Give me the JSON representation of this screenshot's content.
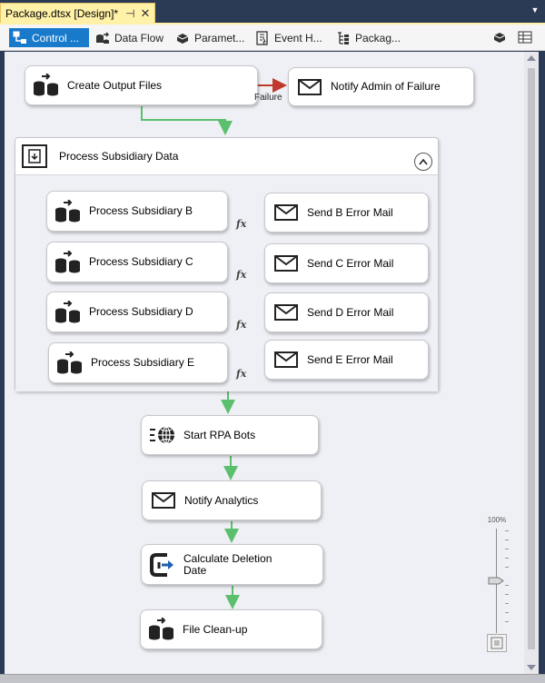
{
  "document_tab": {
    "title": "Package.dtsx [Design]*",
    "pin_glyph": "⊣",
    "close_glyph": "✕"
  },
  "toolbar": {
    "tabs": [
      {
        "label": "Control ...",
        "icon": "control-flow-icon",
        "active": true
      },
      {
        "label": "Data Flow",
        "icon": "data-flow-icon",
        "active": false
      },
      {
        "label": "Paramet...",
        "icon": "parameters-icon",
        "active": false
      },
      {
        "label": "Event H...",
        "icon": "event-handlers-icon",
        "active": false
      },
      {
        "label": "Packag...",
        "icon": "package-explorer-icon",
        "active": false
      }
    ],
    "right_icons": [
      "connection-managers-icon",
      "variables-grid-icon"
    ]
  },
  "tasks": {
    "create_output_files": "Create Output Files",
    "notify_admin": "Notify Admin of Failure",
    "failure_label": "Failure",
    "container_title": "Process Subsidiary Data",
    "process_b": "Process Subsidiary B",
    "process_c": "Process Subsidiary C",
    "process_d": "Process Subsidiary D",
    "process_e": "Process Subsidiary E",
    "send_b": "Send B Error Mail",
    "send_c": "Send C Error Mail",
    "send_d": "Send D Error Mail",
    "send_e": "Send E Error Mail",
    "fx": "fx",
    "start_rpa": "Start RPA Bots",
    "notify_analytics": "Notify Analytics",
    "calc_deletion_line1": "Calculate Deletion",
    "calc_deletion_line2": "Date",
    "file_cleanup": "File Clean-up"
  },
  "zoom": {
    "label": "100%"
  },
  "colors": {
    "success": "#5bbf6e",
    "failure": "#c0392b",
    "active_tab": "#1979ca",
    "doc_tab": "#fff1a8"
  }
}
